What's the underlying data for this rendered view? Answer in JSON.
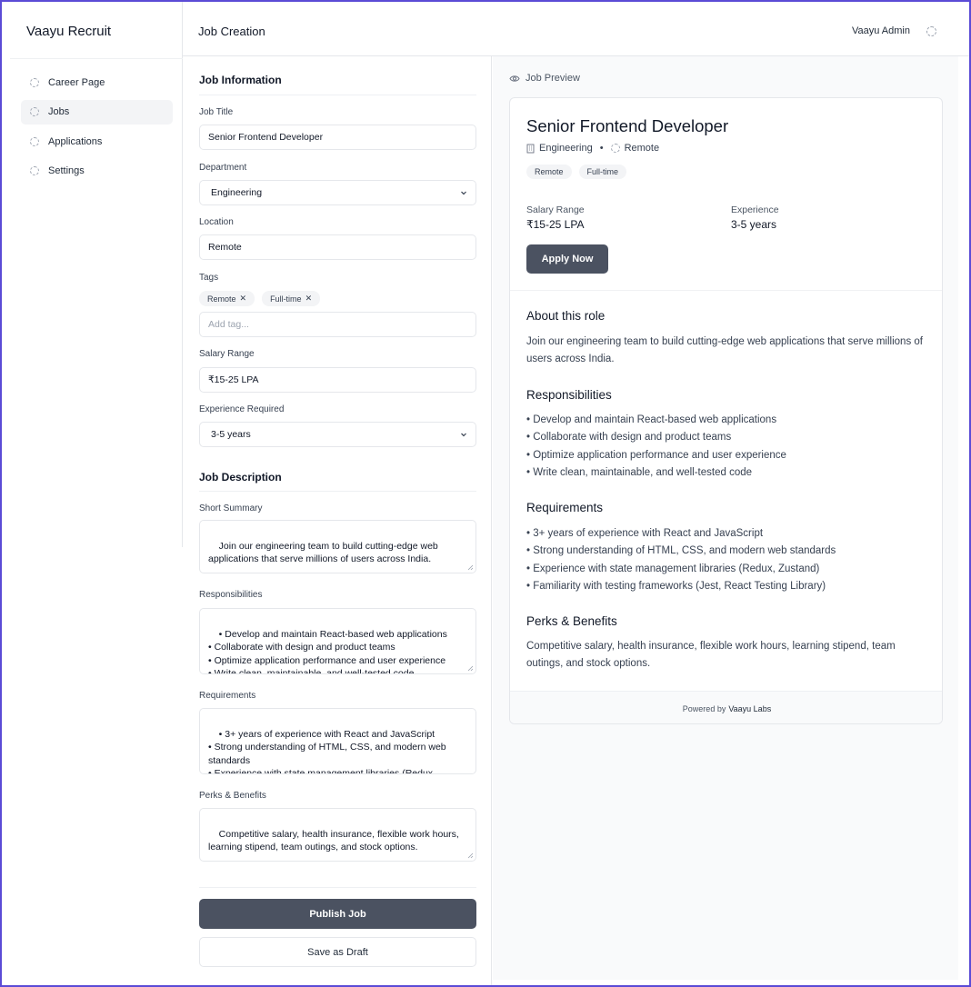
{
  "sidebar": {
    "brand": "Vaayu Recruit",
    "items": [
      {
        "label": "Career Page",
        "icon": "placeholder-circle-icon",
        "active": false
      },
      {
        "label": "Jobs",
        "icon": "placeholder-circle-icon",
        "active": true
      },
      {
        "label": "Applications",
        "icon": "placeholder-circle-icon",
        "active": false
      },
      {
        "label": "Settings",
        "icon": "placeholder-circle-icon",
        "active": false
      }
    ]
  },
  "header": {
    "title": "Job Creation",
    "user_name": "Vaayu Admin",
    "user_icon": "placeholder-circle-icon"
  },
  "form": {
    "job_info_title": "Job Information",
    "job_title_label": "Job Title",
    "job_title_value": "Senior Frontend Developer",
    "department_label": "Department",
    "department_value": "Engineering",
    "location_label": "Location",
    "location_value": "Remote",
    "tags_label": "Tags",
    "tags": [
      "Remote",
      "Full-time"
    ],
    "tag_remove_glyph": "✕",
    "tag_placeholder": "Add tag...",
    "salary_label": "Salary Range",
    "salary_value": "₹15-25 LPA",
    "experience_label": "Experience Required",
    "experience_value": "3-5 years",
    "job_desc_title": "Job Description",
    "summary_label": "Short Summary",
    "summary_value": "Join our engineering team to build cutting-edge web applications that serve millions of users across India.",
    "responsibilities_label": "Responsibilities",
    "responsibilities_value": "• Develop and maintain React-based web applications\n• Collaborate with design and product teams\n• Optimize application performance and user experience\n• Write clean, maintainable, and well-tested code",
    "requirements_label": "Requirements",
    "requirements_value": "• 3+ years of experience with React and JavaScript\n• Strong understanding of HTML, CSS, and modern web standards\n• Experience with state management libraries (Redux, Zustand)",
    "perks_label": "Perks & Benefits",
    "perks_value": "Competitive salary, health insurance, flexible work hours, learning stipend, team outings, and stock options.",
    "publish_label": "Publish Job",
    "draft_label": "Save as Draft"
  },
  "preview": {
    "header_label": "Job Preview",
    "header_icon": "eye-icon",
    "title": "Senior Frontend Developer",
    "department": "Engineering",
    "department_icon": "building-icon",
    "bullet": "•",
    "location": "Remote",
    "location_icon": "placeholder-circle-icon",
    "tags": [
      "Remote",
      "Full-time"
    ],
    "salary_label": "Salary Range",
    "salary_value": "₹15-25 LPA",
    "experience_label": "Experience",
    "experience_value": "3-5 years",
    "apply_label": "Apply Now",
    "about_title": "About this role",
    "about_text": "Join our engineering team to build cutting-edge web applications that serve millions of users across India.",
    "responsibilities_title": "Responsibilities",
    "responsibilities": [
      "• Develop and maintain React-based web applications",
      "• Collaborate with design and product teams",
      "• Optimize application performance and user experience",
      "• Write clean, maintainable, and well-tested code"
    ],
    "requirements_title": "Requirements",
    "requirements": [
      "• 3+ years of experience with React and JavaScript",
      "• Strong understanding of HTML, CSS, and modern web standards",
      "• Experience with state management libraries (Redux, Zustand)",
      "• Familiarity with testing frameworks (Jest, React Testing Library)"
    ],
    "perks_title": "Perks & Benefits",
    "perks_text": "Competitive salary, health insurance, flexible work hours, learning stipend, team outings, and stock options.",
    "footer_prefix": "Powered by",
    "footer_brand": "Vaayu Labs"
  },
  "colors": {
    "primary_button": "#4b5261",
    "frame_border": "#5b4bd6"
  }
}
